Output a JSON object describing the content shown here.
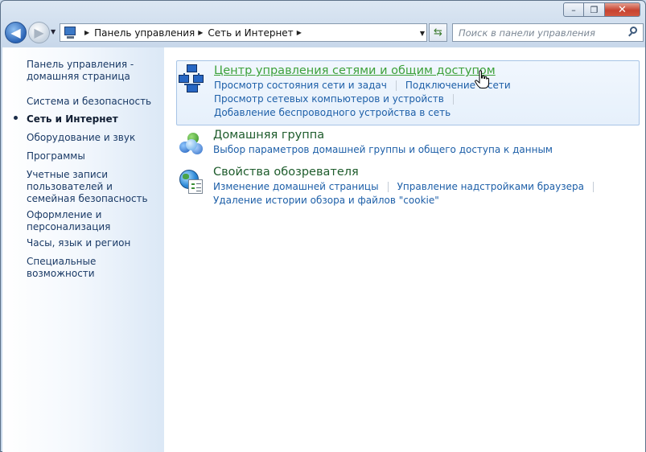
{
  "window": {
    "caption": {
      "minimize": "–",
      "maximize": "❐",
      "close": "✕"
    }
  },
  "nav": {
    "back_icon": "◀",
    "forward_icon": "▶",
    "breadcrumbs": [
      "Панель управления",
      "Сеть и Интернет"
    ],
    "refresh_icon": "⇆",
    "search_placeholder": "Поиск в панели управления"
  },
  "sidebar": {
    "items": [
      {
        "label": "Панель управления - домашняя страница"
      },
      {
        "label": "Система и безопасность"
      },
      {
        "label": "Сеть и Интернет",
        "active": true
      },
      {
        "label": "Оборудование и звук"
      },
      {
        "label": "Программы"
      },
      {
        "label": "Учетные записи пользователей и семейная безопасность"
      },
      {
        "label": "Оформление и персонализация"
      },
      {
        "label": "Часы, язык и регион"
      },
      {
        "label": "Специальные возможности"
      }
    ]
  },
  "sections": [
    {
      "icon": "network-center-icon",
      "title": "Центр управления сетями и общим доступом",
      "links_row1": [
        "Просмотр состояния сети и задач",
        "Подключение к сети"
      ],
      "links_row2": [
        "Просмотр сетевых компьютеров и устройств"
      ],
      "links_row3": [
        "Добавление беспроводного устройства в сеть"
      ]
    },
    {
      "icon": "homegroup-icon",
      "title": "Домашняя группа",
      "links_row1": [
        "Выбор параметров домашней группы и общего доступа к данным"
      ]
    },
    {
      "icon": "internet-options-icon",
      "title": "Свойства обозревателя",
      "links_row1": [
        "Изменение домашней страницы",
        "Управление надстройками браузера"
      ],
      "links_row2": [
        "Удаление истории обзора и файлов \"cookie\""
      ]
    }
  ],
  "colors": {
    "link": "#1d5fa8",
    "title": "#1e5c2c",
    "title_hover": "#3da13a"
  }
}
